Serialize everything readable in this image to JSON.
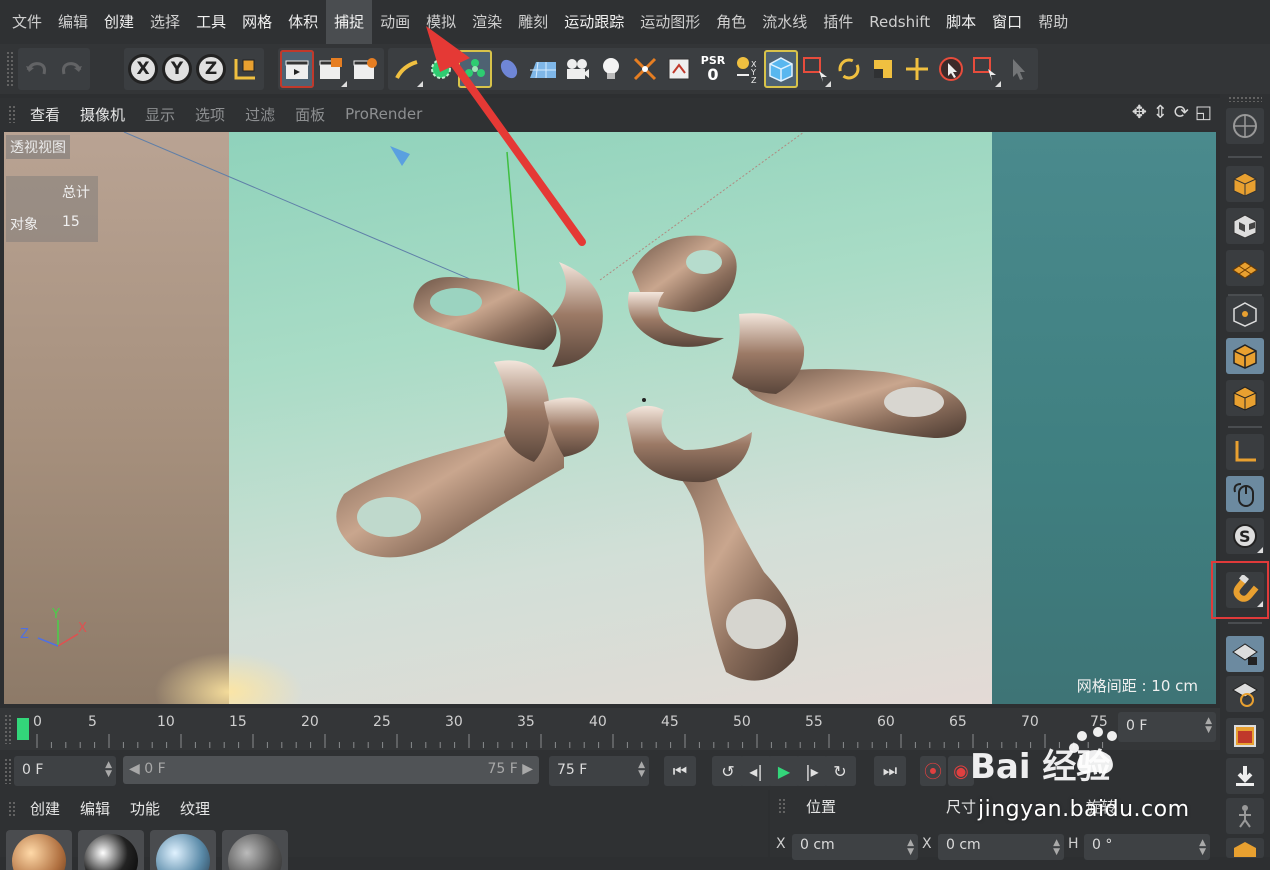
{
  "menubar": {
    "items": [
      "文件",
      "编辑",
      "创建",
      "选择",
      "工具",
      "网格",
      "体积",
      "捕捉",
      "动画",
      "模拟",
      "渲染",
      "雕刻",
      "运动跟踪",
      "运动图形",
      "角色",
      "流水线",
      "插件",
      "Redshift",
      "脚本",
      "窗口",
      "帮助"
    ],
    "hovered": "捕捉"
  },
  "toolbar": {
    "axis_x": "X",
    "axis_y": "Y",
    "axis_z": "Z",
    "psr_label": "PSR",
    "psr_value": "0"
  },
  "viewport": {
    "menu": [
      "查看",
      "摄像机",
      "显示",
      "选项",
      "过滤",
      "面板",
      "ProRender"
    ],
    "perspective_label": "透视视图",
    "stats_total_label": "总计",
    "stats_object_label": "对象",
    "stats_object_count": "15",
    "grid_spacing": "网格间距 : 10 cm",
    "axis_y": "Y",
    "axis_z": "Z",
    "axis_x": "X"
  },
  "timeline": {
    "ticks": [
      "0",
      "5",
      "10",
      "15",
      "20",
      "25",
      "30",
      "35",
      "40",
      "45",
      "50",
      "55",
      "60",
      "65",
      "70",
      "75"
    ],
    "current_frame_field": "0 F"
  },
  "transport": {
    "start_frame": "0 F",
    "range_start": "0 F",
    "range_end": "75 F",
    "end_frame": "75 F"
  },
  "material_panel": {
    "menu": [
      "创建",
      "编辑",
      "功能",
      "纹理"
    ]
  },
  "attributes": {
    "tabs": [
      "位置",
      "尺寸",
      "旋转"
    ],
    "pos_x_label": "X",
    "pos_x_value": "0 cm",
    "size_x_label": "X",
    "size_x_value": "0 cm",
    "rot_h_label": "H",
    "rot_h_value": "0 °"
  },
  "watermark": {
    "logo_text": "Bai 经验",
    "url": "jingyan.baidu.com"
  },
  "colors": {
    "accent_yellow": "#d8c34a",
    "highlight_red": "#e03a3a",
    "timeline_handle": "#33d67a"
  }
}
